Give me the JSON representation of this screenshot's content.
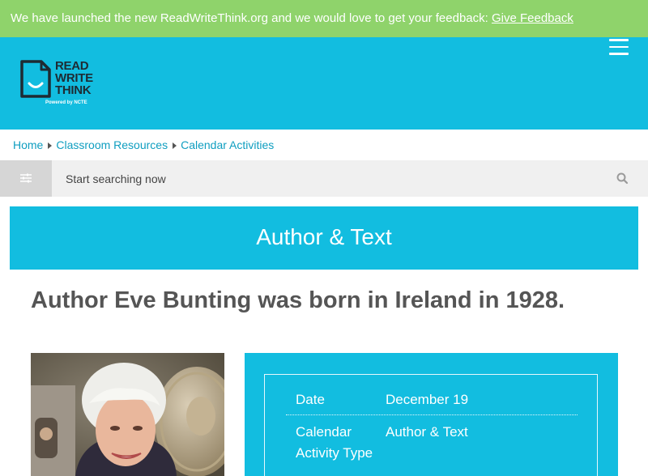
{
  "banner": {
    "text": "We have launched the new ReadWriteThink.org and we would love to get your feedback: ",
    "link_label": "Give Feedback"
  },
  "logo": {
    "line1": "READ",
    "line2": "WRITE",
    "line3": "THINK",
    "powered": "Powered by NCTE"
  },
  "breadcrumb": {
    "items": [
      "Home",
      "Classroom Resources",
      "Calendar Activities"
    ]
  },
  "search": {
    "placeholder": "Start searching now"
  },
  "category_title": "Author & Text",
  "headline": "Author Eve Bunting was born in Ireland in 1928.",
  "details": {
    "date_label": "Date",
    "date_value": "December 19",
    "type_label": "Calendar Activity Type",
    "type_value": "Author & Text"
  },
  "colors": {
    "banner": "#8fd36b",
    "brand": "#12bde0",
    "link": "#0f9ec0",
    "heading_text": "#555555"
  }
}
